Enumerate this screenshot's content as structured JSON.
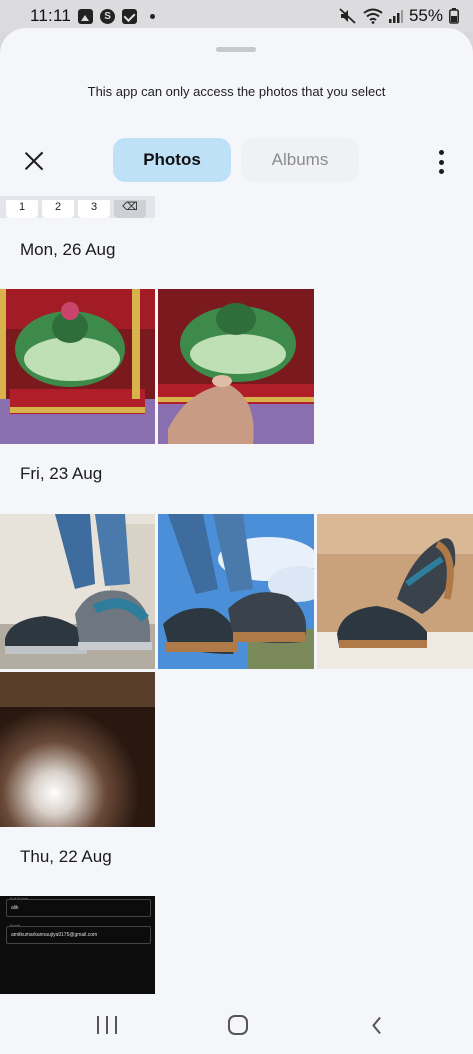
{
  "status_bar": {
    "time": "11:11",
    "battery": "55%",
    "icons": [
      "gallery-icon",
      "skype-icon",
      "check-icon",
      "dot-icon",
      "mute-icon",
      "wifi-icon",
      "signal-icon",
      "battery-icon"
    ]
  },
  "sheet": {
    "notice": "This app can only access the photos that you select"
  },
  "toolbar": {
    "tabs": [
      {
        "label": "Photos",
        "selected": true
      },
      {
        "label": "Albums",
        "selected": false
      }
    ]
  },
  "keyboard_strip": {
    "keys": [
      "1",
      "2",
      "3"
    ]
  },
  "sections": [
    {
      "date": "Mon, 26 Aug",
      "photo_count": 2
    },
    {
      "date": "Fri, 23 Aug",
      "photo_count": 4
    },
    {
      "date": "Thu, 22 Aug",
      "photo_count": 1
    }
  ],
  "screenshot_thumb": {
    "field1_label": "Full Name",
    "field1_value": "alik",
    "field2_label": "Email",
    "field2_value": "amitkumarkannaujiya9175@gmail.com"
  },
  "colors": {
    "selected_tab": "#bfe1f8",
    "sheet_bg": "#f5f6fa"
  }
}
